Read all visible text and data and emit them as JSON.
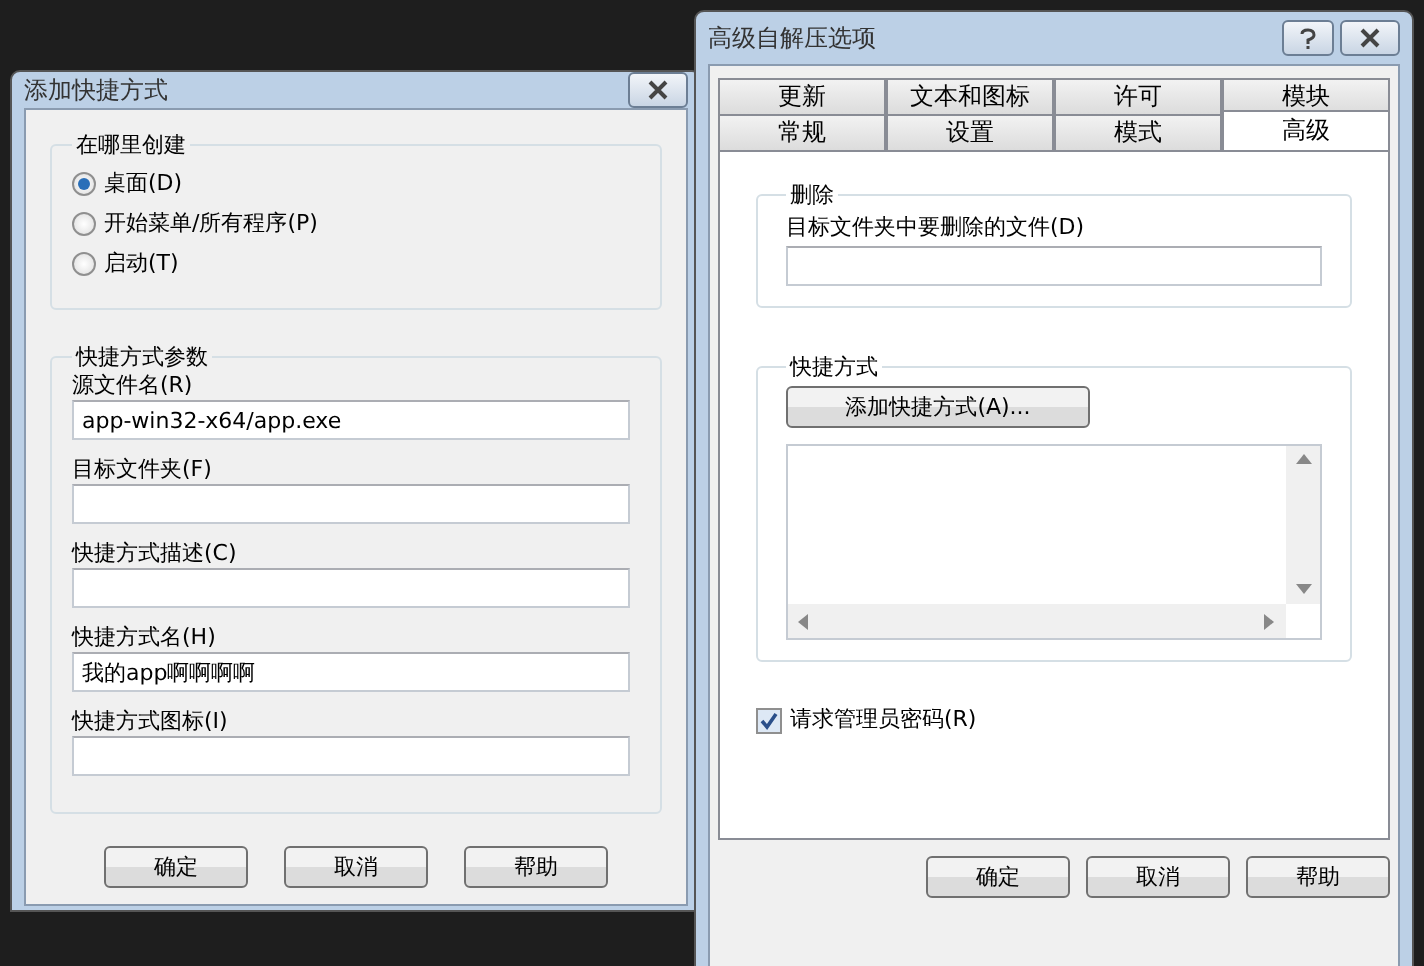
{
  "shortcut_dialog": {
    "title": "添加快捷方式",
    "location_group": {
      "title": "在哪里创建",
      "options": [
        {
          "label": "桌面(D)",
          "selected": true
        },
        {
          "label": "开始菜单/所有程序(P)",
          "selected": false
        },
        {
          "label": "启动(T)",
          "selected": false
        }
      ]
    },
    "params_group": {
      "title": "快捷方式参数",
      "fields": [
        {
          "label": "源文件名(R)",
          "value": "app-win32-x64/app.exe"
        },
        {
          "label": "目标文件夹(F)"
        },
        {
          "label": "快捷方式描述(C)"
        },
        {
          "label": "快捷方式名(H)",
          "value": "我的app啊啊啊啊"
        },
        {
          "label": "快捷方式图标(I)"
        }
      ]
    },
    "buttons": [
      "确定",
      "取消",
      "帮助"
    ]
  },
  "options_dialog": {
    "title": "高级自解压选项",
    "tab_rows": [
      [
        {
          "label": "更新",
          "selected": false
        },
        {
          "label": "文本和图标",
          "selected": false
        },
        {
          "label": "许可",
          "selected": false
        },
        {
          "label": "模块",
          "selected": false
        }
      ],
      [
        {
          "label": "常规",
          "selected": false
        },
        {
          "label": "设置",
          "selected": false
        },
        {
          "label": "模式",
          "selected": false
        },
        {
          "label": "高级",
          "selected": true
        }
      ]
    ],
    "delete_group": {
      "title": "删除",
      "field_label": "目标文件夹中要删除的文件(D)"
    },
    "shortcut_group": {
      "title": "快捷方式",
      "button": "添加快捷方式(A)..."
    },
    "admin_checkbox": {
      "label": "请求管理员密码(R)",
      "checked": true
    },
    "buttons": [
      "确定",
      "取消",
      "帮助"
    ]
  }
}
